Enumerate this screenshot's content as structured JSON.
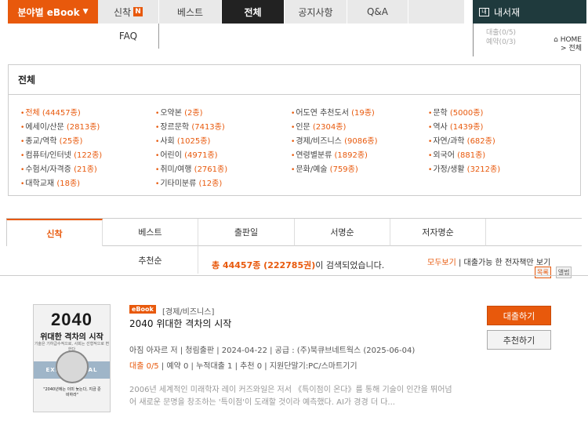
{
  "nav": {
    "category_btn": "분야별 eBook",
    "new": "신착",
    "new_badge": "N",
    "best": "베스트",
    "all": "전체",
    "notice": "공지사항",
    "qna_top": "Q&A",
    "faq": "FAQ",
    "mylib": "내서재",
    "mylib_icon_text": "내",
    "loan_count": "대출(0/5)",
    "reserve_count": "예약(0/3)",
    "home": "HOME",
    "crumb": "전체"
  },
  "category": {
    "title": "전체",
    "items": [
      {
        "label": "전체",
        "count": "(44457종)"
      },
      {
        "label": "오약본",
        "count": "(2종)"
      },
      {
        "label": "어도연 추천도서",
        "count": "(19종)"
      },
      {
        "label": "문학",
        "count": "(5000종)"
      },
      {
        "label": "에세이/산문",
        "count": "(2813종)"
      },
      {
        "label": "장르문학",
        "count": "(7413종)"
      },
      {
        "label": "인문",
        "count": "(2304종)"
      },
      {
        "label": "역사",
        "count": "(1439종)"
      },
      {
        "label": "종교/역학",
        "count": "(25종)"
      },
      {
        "label": "사회",
        "count": "(1025종)"
      },
      {
        "label": "경제/비즈니스",
        "count": "(9086종)"
      },
      {
        "label": "자연/과학",
        "count": "(682종)"
      },
      {
        "label": "컴퓨터/인터넷",
        "count": "(122종)"
      },
      {
        "label": "어린이",
        "count": "(4971종)"
      },
      {
        "label": "연령별분류",
        "count": "(1892종)"
      },
      {
        "label": "외국어",
        "count": "(881종)"
      },
      {
        "label": "수험서/자격증",
        "count": "(21종)"
      },
      {
        "label": "취미/여행",
        "count": "(2761종)"
      },
      {
        "label": "문화/예술",
        "count": "(759종)"
      },
      {
        "label": "가정/생활",
        "count": "(3212종)"
      },
      {
        "label": "대학교재",
        "count": "(18종)"
      },
      {
        "label": "기타미분류",
        "count": "(12종)"
      }
    ]
  },
  "sort": {
    "tabs": [
      "신착",
      "베스트",
      "출판일",
      "서명순",
      "저자명순"
    ],
    "recommend": "추천순"
  },
  "result": {
    "count_text": "총 44457종 (222785권)",
    "suffix": "이 검색되었습니다.",
    "filter_all": "모두보기",
    "filter_sep": " | ",
    "filter_available": "대출가능 한 전자책만 보기",
    "view_list": "목록",
    "view_grid": "앨범"
  },
  "book": {
    "tag": "eBook",
    "category": "[경제/비즈니스]",
    "title": "2040 위대한 격차의 시작",
    "meta": "아짐 아자르 저 | 청림출판 | 2024-04-22 | 공급 : (주)북큐브네트웍스 (2025-06-04)",
    "loan": "대출 0/5",
    "stats_rest": " | 예약 0 | 누적대출 1 | 추천 0 | 지원단말기:PC/스마트기기",
    "desc": "2006년 세계적인 미래학자 레이 커즈와일은 저서 《특이점이 온다》를 통해 기술이 인간을 뛰어넘어 새로운 문명을 창조하는 '특이점'이 도래할 것이라 예측했다. AI가 경경 더 다...",
    "cover_title": "2040",
    "cover_subtitle": "위대한 격차의 시작",
    "cover_tagline": "기술은 기하급수적으로, 사회는 선형적으로 변한다",
    "cover_band": "EXPONENTIAL",
    "cover_quote": "\"2040년에는 이미 늦는다, 지금 준비하라\"",
    "borrow": "대출하기",
    "recommend": "추천하기"
  }
}
